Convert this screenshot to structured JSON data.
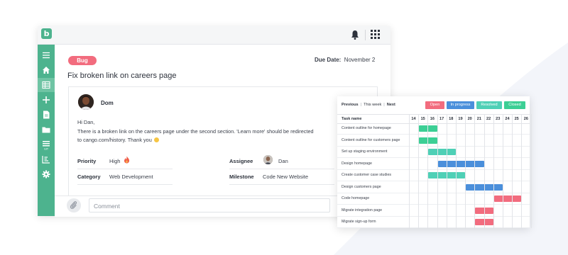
{
  "colors": {
    "accent_green": "#4db38e",
    "bug_red": "#f26c7e",
    "open": "#f26c7e",
    "in_progress": "#4a8fdb",
    "resolved": "#4fd0b6",
    "closed": "#3ccf95"
  },
  "app": {
    "logo": "b",
    "icons": [
      "bell-icon",
      "apps-grid-icon"
    ],
    "sidebar": [
      "menu-icon",
      "home-icon",
      "table-icon",
      "plus-icon",
      "document-icon",
      "folder-icon",
      "git-icon",
      "chart-icon",
      "gear-icon"
    ]
  },
  "issue": {
    "badge": "Bug",
    "due_label": "Due Date:",
    "due_value": "November 2",
    "title": "Fix broken link on careers page",
    "author": "Dom",
    "greeting": "Hi Dan,",
    "body_line1": "There is a broken link on the careers page under the second section. 'Learn more' should be redirected",
    "body_line2": "to cango.com/history. Thank you",
    "priority_label": "Priority",
    "priority_value": "High",
    "category_label": "Category",
    "category_value": "Web Development",
    "assignee_label": "Assignee",
    "assignee_value": "Dan",
    "milestone_label": "Milestone",
    "milestone_value": "Code New Website",
    "comment_placeholder": "Comment"
  },
  "gantt": {
    "nav_previous": "Previous",
    "nav_this_week": "This week",
    "nav_next": "Next",
    "legend": [
      "Open",
      "In progress",
      "Resolved",
      "Closed"
    ],
    "task_header": "Task name",
    "days": [
      "14",
      "15",
      "16",
      "17",
      "18",
      "19",
      "20",
      "21",
      "22",
      "23",
      "24",
      "25",
      "26"
    ],
    "tasks": [
      {
        "name": "Content outline for homepage",
        "start": "15",
        "end": "17",
        "status": "Closed"
      },
      {
        "name": "Content outline for customers page",
        "start": "15",
        "end": "17",
        "status": "Closed"
      },
      {
        "name": "Set up staging environment",
        "start": "16",
        "end": "19",
        "status": "Resolved"
      },
      {
        "name": "Design homepage",
        "start": "17",
        "end": "22",
        "status": "In progress"
      },
      {
        "name": "Create customer case studies",
        "start": "16",
        "end": "20",
        "status": "Resolved"
      },
      {
        "name": "Design customers page",
        "start": "20",
        "end": "24",
        "status": "In progress"
      },
      {
        "name": "Code homepage",
        "start": "23",
        "end": "26",
        "status": "Open"
      },
      {
        "name": "Migrate integration page",
        "start": "21",
        "end": "23",
        "status": "Open"
      },
      {
        "name": "Migrate sign-up form",
        "start": "21",
        "end": "23",
        "status": "Open"
      }
    ]
  }
}
